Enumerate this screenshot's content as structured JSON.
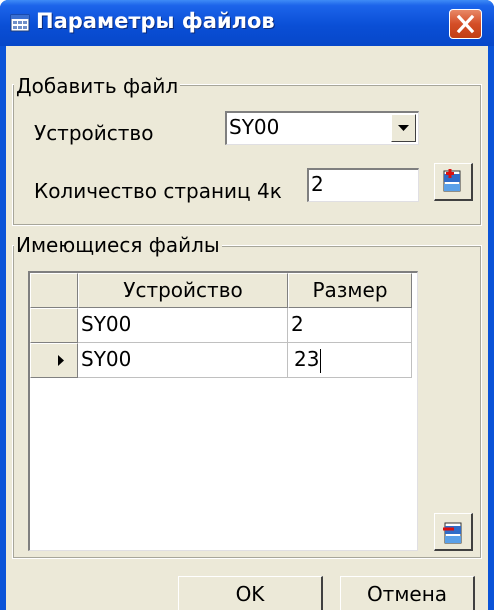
{
  "window": {
    "title": "Параметры файлов",
    "icon": "window-app-icon",
    "close_icon": "close-icon"
  },
  "add_file": {
    "group_title": "Добавить файл",
    "device_label": "Устройство",
    "device_value": "SY00",
    "pages_label": "Количество страниц 4к",
    "pages_value": "2",
    "add_button_icon": "add-file-icon"
  },
  "existing_files": {
    "group_title": "Имеющиеся файлы",
    "columns": [
      "Устройство",
      "Размер"
    ],
    "rows": [
      {
        "device": "SY00",
        "size": "2",
        "current": false
      },
      {
        "device": "SY00",
        "size": "23",
        "current": true
      }
    ],
    "row_pointer_icon": "row-pointer-icon",
    "remove_button_icon": "remove-file-icon"
  },
  "buttons": {
    "ok": "OK",
    "cancel": "Отмена"
  }
}
